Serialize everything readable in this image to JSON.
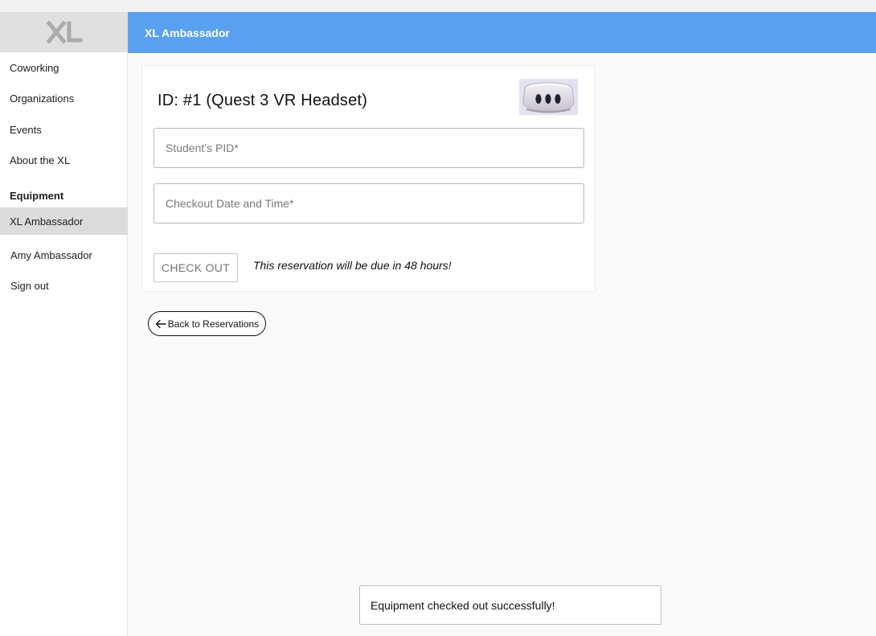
{
  "app": {
    "header_title": "XL Ambassador",
    "accent_color": "#5aa0f0"
  },
  "sidebar": {
    "logo_icon": "xl-logo-icon",
    "items": [
      {
        "label": "Coworking"
      },
      {
        "label": "Organizations"
      },
      {
        "label": "Events"
      },
      {
        "label": "About the XL"
      }
    ],
    "section_heading": "Equipment",
    "active_item": "XL Ambassador",
    "user_name": "Amy Ambassador",
    "sign_out": "Sign out"
  },
  "card": {
    "title": "ID: #1 (Quest 3 VR Headset)",
    "image_icon": "vr-headset-image",
    "pid_placeholder": "Student’s PID*",
    "datetime_placeholder": "Checkout Date and Time*",
    "checkout_label": "CHECK OUT",
    "due_note": "This reservation will be due in 48 hours!"
  },
  "back": {
    "label": "Back to Reservations",
    "icon": "arrow-left-icon"
  },
  "toast": {
    "message": "Equipment checked out successfully!"
  }
}
